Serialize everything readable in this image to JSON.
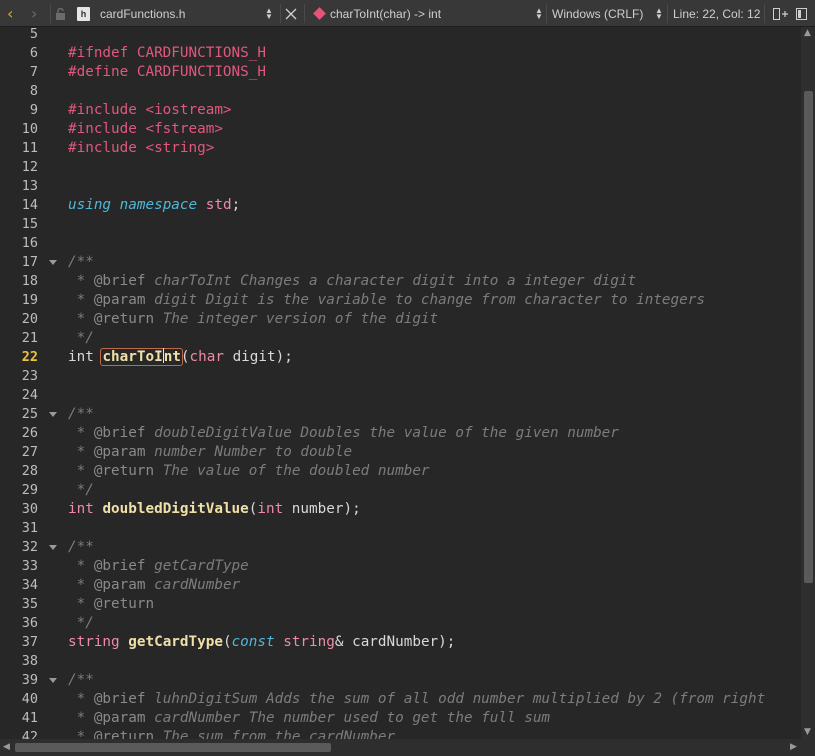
{
  "toolbar": {
    "back_icon": "chevron-left-icon",
    "forward_icon": "chevron-right-icon",
    "file_type_letter": "h",
    "file_name": "cardFunctions.h",
    "symbol": "charToInt(char) -> int",
    "line_ending": "Windows (CRLF)",
    "cursor_position": "Line: 22, Col: 12"
  },
  "editor": {
    "current_line": 22,
    "lines": [
      {
        "n": "5",
        "fold": false,
        "t": []
      },
      {
        "n": "6",
        "fold": false,
        "t": [
          [
            "pre",
            "#ifndef CARDFUNCTIONS_H"
          ]
        ]
      },
      {
        "n": "7",
        "fold": false,
        "t": [
          [
            "pre",
            "#define CARDFUNCTIONS_H"
          ]
        ]
      },
      {
        "n": "8",
        "fold": false,
        "t": []
      },
      {
        "n": "9",
        "fold": false,
        "t": [
          [
            "pre",
            "#include <iostream>"
          ]
        ]
      },
      {
        "n": "10",
        "fold": false,
        "t": [
          [
            "pre",
            "#include <fstream>"
          ]
        ]
      },
      {
        "n": "11",
        "fold": false,
        "t": [
          [
            "pre",
            "#include <string>"
          ]
        ]
      },
      {
        "n": "12",
        "fold": false,
        "t": []
      },
      {
        "n": "13",
        "fold": false,
        "t": []
      },
      {
        "n": "14",
        "fold": false,
        "t": [
          [
            "ital",
            "using"
          ],
          [
            "plain",
            " "
          ],
          [
            "ital",
            "namespace"
          ],
          [
            "plain",
            " "
          ],
          [
            "kw",
            "std"
          ],
          [
            "plain",
            ";"
          ]
        ]
      },
      {
        "n": "15",
        "fold": false,
        "t": []
      },
      {
        "n": "16",
        "fold": false,
        "t": []
      },
      {
        "n": "17",
        "fold": true,
        "t": [
          [
            "cm",
            "/**"
          ]
        ]
      },
      {
        "n": "18",
        "fold": false,
        "t": [
          [
            "cm",
            " * "
          ],
          [
            "cmtag",
            "@brief"
          ],
          [
            "cm",
            " charToInt Changes a character digit into a integer digit"
          ]
        ]
      },
      {
        "n": "19",
        "fold": false,
        "t": [
          [
            "cm",
            " * "
          ],
          [
            "cmtag",
            "@param"
          ],
          [
            "cm",
            " digit Digit is the variable to change from character to integers"
          ]
        ]
      },
      {
        "n": "20",
        "fold": false,
        "t": [
          [
            "cm",
            " * "
          ],
          [
            "cmtag",
            "@return"
          ],
          [
            "cm",
            " The integer version of the digit"
          ]
        ]
      },
      {
        "n": "21",
        "fold": false,
        "t": [
          [
            "cm",
            " */"
          ]
        ]
      },
      {
        "n": "22",
        "fold": false,
        "t": [
          [
            "plain",
            "int "
          ],
          [
            "hlA",
            "charToI"
          ],
          [
            "caret",
            ""
          ],
          [
            "hlB",
            "nt"
          ],
          [
            "plain",
            "("
          ],
          [
            "type",
            "char"
          ],
          [
            "plain",
            " digit);"
          ]
        ]
      },
      {
        "n": "23",
        "fold": false,
        "t": []
      },
      {
        "n": "24",
        "fold": false,
        "t": []
      },
      {
        "n": "25",
        "fold": true,
        "t": [
          [
            "cm",
            "/**"
          ]
        ]
      },
      {
        "n": "26",
        "fold": false,
        "t": [
          [
            "cm",
            " * "
          ],
          [
            "cmtag",
            "@brief"
          ],
          [
            "cm",
            " doubleDigitValue Doubles the value of the given number"
          ]
        ]
      },
      {
        "n": "27",
        "fold": false,
        "t": [
          [
            "cm",
            " * "
          ],
          [
            "cmtag",
            "@param"
          ],
          [
            "cm",
            " number Number to double"
          ]
        ]
      },
      {
        "n": "28",
        "fold": false,
        "t": [
          [
            "cm",
            " * "
          ],
          [
            "cmtag",
            "@return"
          ],
          [
            "cm",
            " The value of the doubled number"
          ]
        ]
      },
      {
        "n": "29",
        "fold": false,
        "t": [
          [
            "cm",
            " */"
          ]
        ]
      },
      {
        "n": "30",
        "fold": false,
        "t": [
          [
            "type",
            "int"
          ],
          [
            "plain",
            " "
          ],
          [
            "func",
            "doubledDigitValue"
          ],
          [
            "plain",
            "("
          ],
          [
            "type",
            "int"
          ],
          [
            "plain",
            " number);"
          ]
        ]
      },
      {
        "n": "31",
        "fold": false,
        "t": []
      },
      {
        "n": "32",
        "fold": true,
        "t": [
          [
            "cm",
            "/**"
          ]
        ]
      },
      {
        "n": "33",
        "fold": false,
        "t": [
          [
            "cm",
            " * "
          ],
          [
            "cmtag",
            "@brief"
          ],
          [
            "cm",
            " getCardType"
          ]
        ]
      },
      {
        "n": "34",
        "fold": false,
        "t": [
          [
            "cm",
            " * "
          ],
          [
            "cmtag",
            "@param"
          ],
          [
            "cm",
            " cardNumber"
          ]
        ]
      },
      {
        "n": "35",
        "fold": false,
        "t": [
          [
            "cm",
            " * "
          ],
          [
            "cmtag",
            "@return"
          ]
        ]
      },
      {
        "n": "36",
        "fold": false,
        "t": [
          [
            "cm",
            " */"
          ]
        ]
      },
      {
        "n": "37",
        "fold": false,
        "t": [
          [
            "type",
            "string"
          ],
          [
            "plain",
            " "
          ],
          [
            "func",
            "getCardType"
          ],
          [
            "plain",
            "("
          ],
          [
            "ital",
            "const"
          ],
          [
            "plain",
            " "
          ],
          [
            "type",
            "string"
          ],
          [
            "plain",
            "& cardNumber);"
          ]
        ]
      },
      {
        "n": "38",
        "fold": false,
        "t": []
      },
      {
        "n": "39",
        "fold": true,
        "t": [
          [
            "cm",
            "/**"
          ]
        ]
      },
      {
        "n": "40",
        "fold": false,
        "t": [
          [
            "cm",
            " * "
          ],
          [
            "cmtag",
            "@brief"
          ],
          [
            "cm",
            " luhnDigitSum Adds the sum of all odd number multiplied by 2 (from right"
          ]
        ]
      },
      {
        "n": "41",
        "fold": false,
        "t": [
          [
            "cm",
            " * "
          ],
          [
            "cmtag",
            "@param"
          ],
          [
            "cm",
            " cardNumber The number used to get the full sum"
          ]
        ]
      },
      {
        "n": "42",
        "fold": false,
        "t": [
          [
            "cm",
            " * "
          ],
          [
            "cmtag",
            "@return"
          ],
          [
            "cm",
            " The sum from the cardNumber"
          ]
        ]
      }
    ]
  }
}
